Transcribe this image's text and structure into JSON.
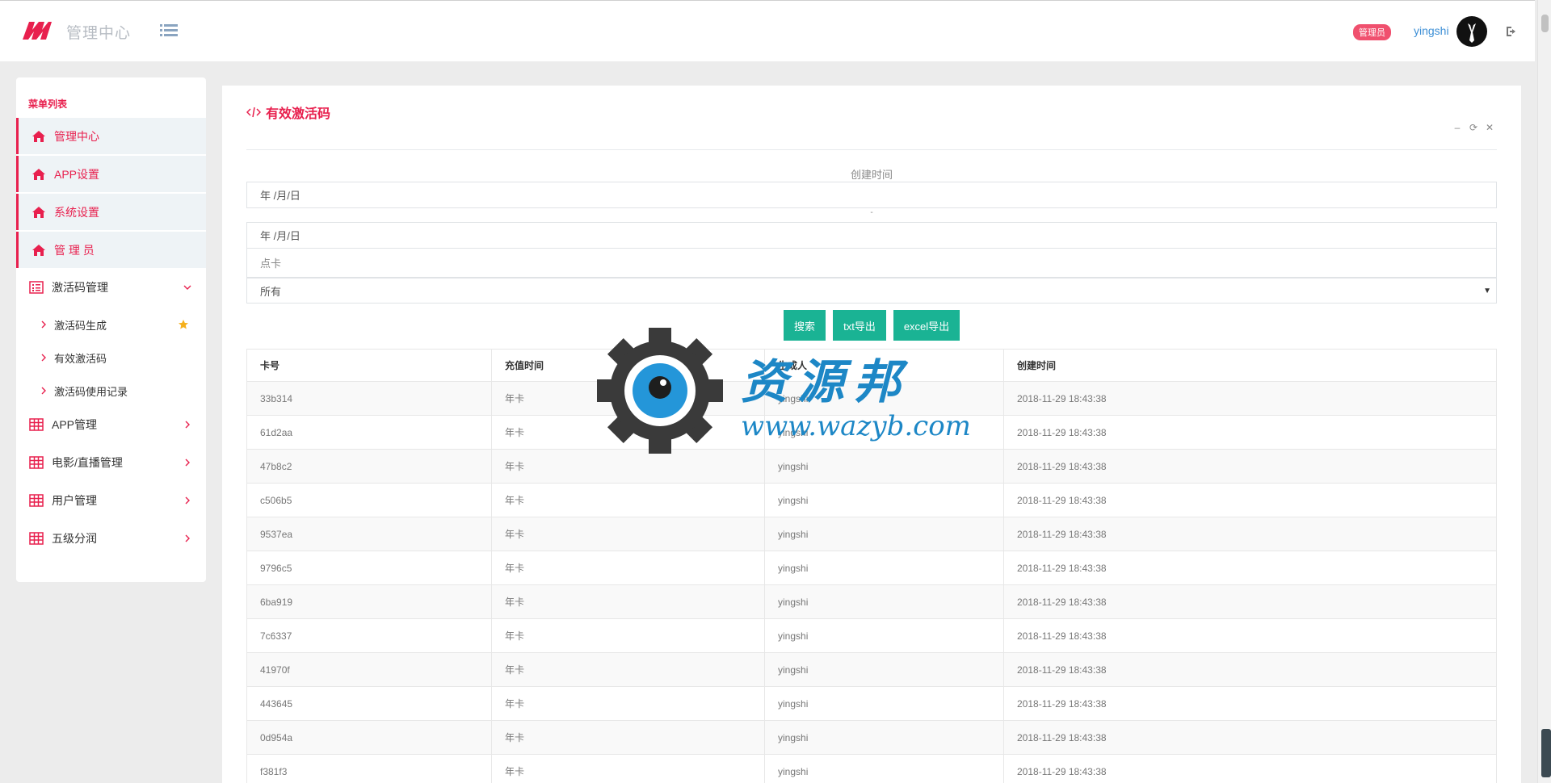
{
  "header": {
    "app_title": "管理中心",
    "role_badge": "管理员",
    "username": "yingshi"
  },
  "colors": {
    "accent": "#e8204e",
    "button": "#1ab394",
    "link": "#3d8fd6"
  },
  "sidebar": {
    "title": "菜单列表",
    "items": [
      {
        "label": "管理中心",
        "icon": "home-icon",
        "active": true
      },
      {
        "label": "APP设置",
        "icon": "home-icon",
        "active": true
      },
      {
        "label": "系统设置",
        "icon": "home-icon",
        "active": true
      },
      {
        "label": "管 理 员",
        "icon": "home-icon",
        "active": true
      },
      {
        "label": "激活码管理",
        "icon": "list-icon",
        "expanded": true
      },
      {
        "label": "APP管理",
        "icon": "table-icon"
      },
      {
        "label": "电影/直播管理",
        "icon": "table-icon"
      },
      {
        "label": "用户管理",
        "icon": "table-icon"
      },
      {
        "label": "五级分润",
        "icon": "table-icon"
      }
    ],
    "subitems": [
      {
        "label": "激活码生成",
        "starred": true
      },
      {
        "label": "有效激活码"
      },
      {
        "label": "激活码使用记录"
      }
    ]
  },
  "main": {
    "title": "有效激活码",
    "tools": {
      "minimize": "–",
      "refresh": "⟳",
      "close": "✕"
    },
    "filters": {
      "created_label": "创建时间",
      "date_from": "年 /月/日",
      "separator": "-",
      "date_to": "年 /月/日",
      "card_placeholder": "点卡",
      "status_select": "所有"
    },
    "buttons": {
      "search": "搜索",
      "txt_export": "txt导出",
      "excel_export": "excel导出"
    },
    "table": {
      "headers": [
        "卡号",
        "充值时间",
        "生成人",
        "创建时间"
      ],
      "rows": [
        [
          "33b314",
          "年卡",
          "yingshi",
          "2018-11-29 18:43:38"
        ],
        [
          "61d2aa",
          "年卡",
          "yingshi",
          "2018-11-29 18:43:38"
        ],
        [
          "47b8c2",
          "年卡",
          "yingshi",
          "2018-11-29 18:43:38"
        ],
        [
          "c506b5",
          "年卡",
          "yingshi",
          "2018-11-29 18:43:38"
        ],
        [
          "9537ea",
          "年卡",
          "yingshi",
          "2018-11-29 18:43:38"
        ],
        [
          "9796c5",
          "年卡",
          "yingshi",
          "2018-11-29 18:43:38"
        ],
        [
          "6ba919",
          "年卡",
          "yingshi",
          "2018-11-29 18:43:38"
        ],
        [
          "7c6337",
          "年卡",
          "yingshi",
          "2018-11-29 18:43:38"
        ],
        [
          "41970f",
          "年卡",
          "yingshi",
          "2018-11-29 18:43:38"
        ],
        [
          "443645",
          "年卡",
          "yingshi",
          "2018-11-29 18:43:38"
        ],
        [
          "0d954a",
          "年卡",
          "yingshi",
          "2018-11-29 18:43:38"
        ],
        [
          "f381f3",
          "年卡",
          "yingshi",
          "2018-11-29 18:43:38"
        ]
      ]
    }
  },
  "watermark": {
    "name": "资源邦",
    "url": "www.wazyb.com"
  }
}
